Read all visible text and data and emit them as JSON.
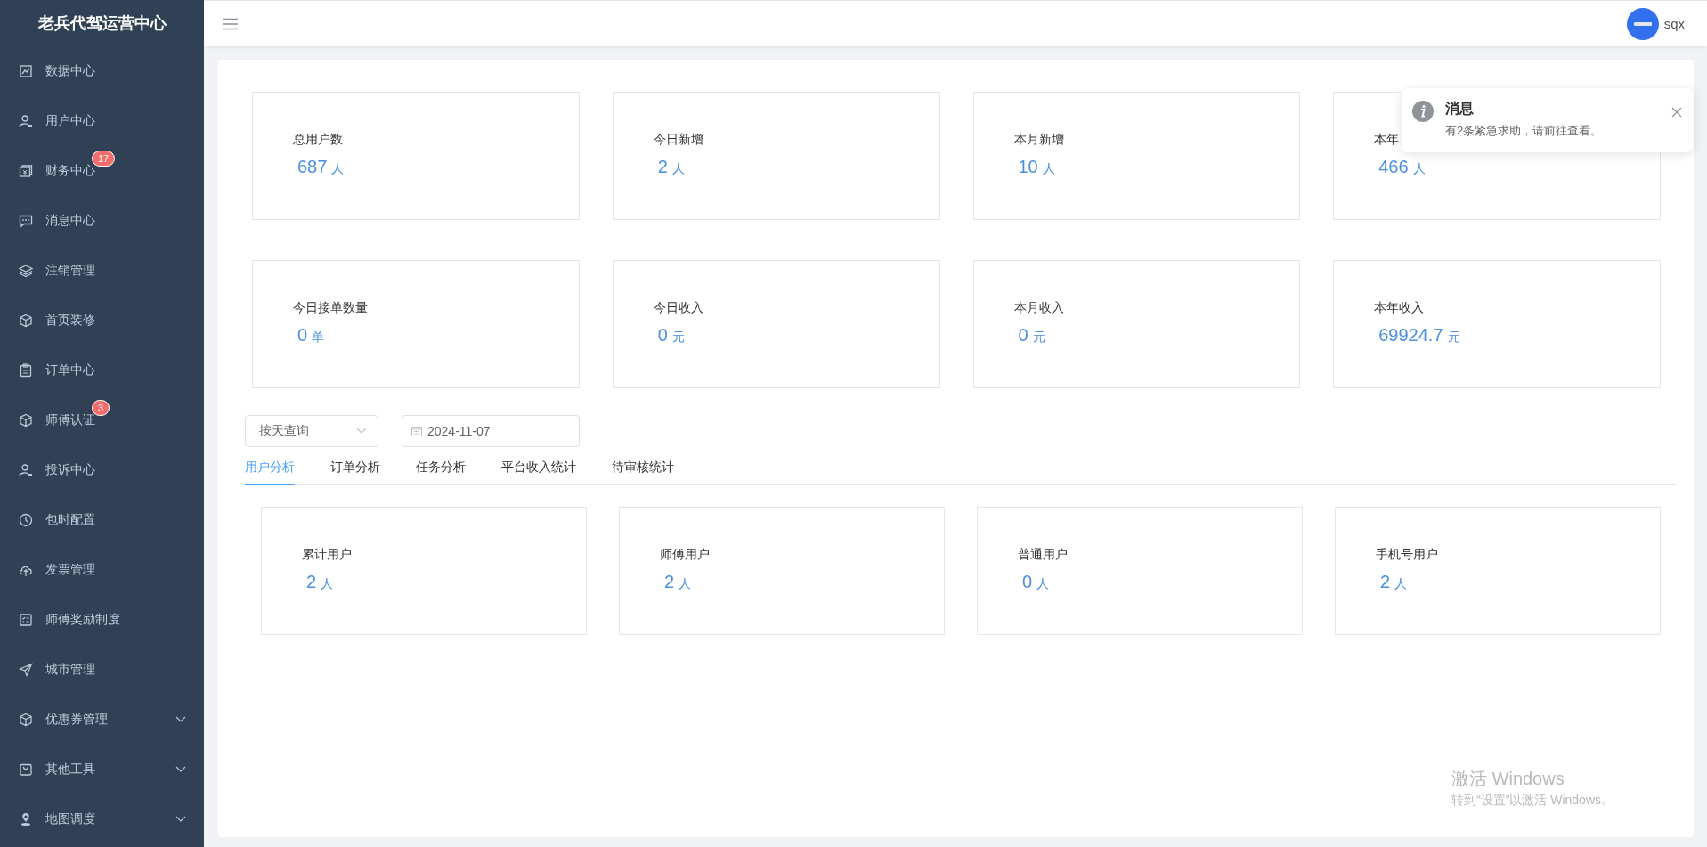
{
  "sidebar": {
    "title": "老兵代驾运营中心",
    "items": [
      {
        "label": "数据中心"
      },
      {
        "label": "用户中心"
      },
      {
        "label": "财务中心",
        "badge": "17"
      },
      {
        "label": "消息中心"
      },
      {
        "label": "注销管理"
      },
      {
        "label": "首页装修"
      },
      {
        "label": "订单中心"
      },
      {
        "label": "师傅认证",
        "badge": "3"
      },
      {
        "label": "投诉中心"
      },
      {
        "label": "包时配置"
      },
      {
        "label": "发票管理"
      },
      {
        "label": "师傅奖励制度"
      },
      {
        "label": "城市管理"
      },
      {
        "label": "优惠券管理",
        "expanded": false
      },
      {
        "label": "其他工具",
        "expanded": false
      },
      {
        "label": "地图调度",
        "expanded": false
      }
    ]
  },
  "header": {
    "username": "sqx"
  },
  "stats": [
    {
      "label": "总用户数",
      "value": "687",
      "unit": "人"
    },
    {
      "label": "今日新增",
      "value": "2",
      "unit": "人"
    },
    {
      "label": "本月新增",
      "value": "10",
      "unit": "人"
    },
    {
      "label": "本年",
      "value": "466",
      "unit": "人"
    },
    {
      "label": "今日接单数量",
      "value": "0",
      "unit": "单"
    },
    {
      "label": "今日收入",
      "value": "0",
      "unit": "元"
    },
    {
      "label": "本月收入",
      "value": "0",
      "unit": "元"
    },
    {
      "label": "本年收入",
      "value": "69924.7",
      "unit": "元"
    }
  ],
  "filters": {
    "mode": "按天查询",
    "date": "2024-11-07"
  },
  "tabs": [
    {
      "label": "用户分析",
      "selected": true
    },
    {
      "label": "订单分析",
      "selected": false
    },
    {
      "label": "任务分析",
      "selected": false
    },
    {
      "label": "平台收入统计",
      "selected": false
    },
    {
      "label": "待审核统计",
      "selected": false
    }
  ],
  "user_stats": [
    {
      "label": "累计用户",
      "value": "2",
      "unit": "人"
    },
    {
      "label": "师傅用户",
      "value": "2",
      "unit": "人"
    },
    {
      "label": "普通用户",
      "value": "0",
      "unit": "人"
    },
    {
      "label": "手机号用户",
      "value": "2",
      "unit": "人"
    }
  ],
  "notification": {
    "title": "消息",
    "message": "有2条紧急求助，请前往查看。"
  },
  "os_overlay": {
    "title": "激活 Windows",
    "message": "转到“设置”以激活 Windows。"
  }
}
